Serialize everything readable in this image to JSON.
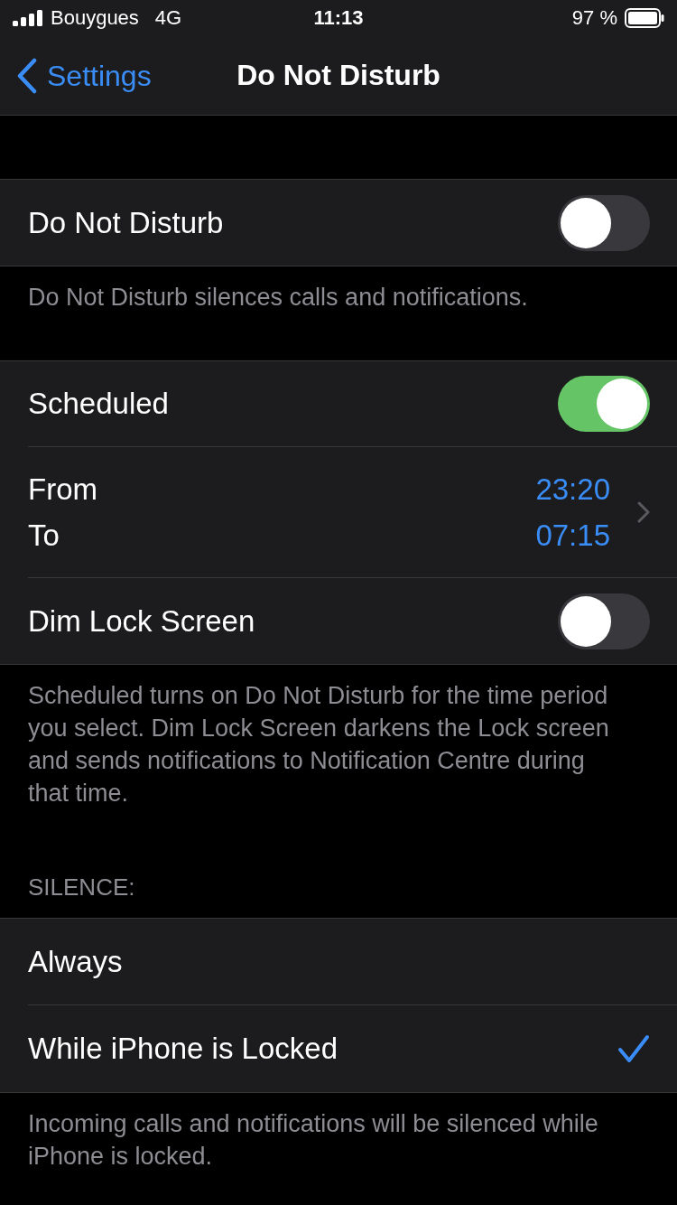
{
  "status_bar": {
    "carrier": "Bouygues",
    "network": "4G",
    "time": "11:13",
    "battery": "97 %"
  },
  "nav": {
    "back": "Settings",
    "title": "Do Not Disturb"
  },
  "sections": [
    {
      "rows": [
        {
          "kind": "toggle",
          "label": "Do Not Disturb",
          "on": false
        }
      ],
      "footer": "Do Not Disturb silences calls and notifications."
    },
    {
      "rows": [
        {
          "kind": "toggle",
          "label": "Scheduled",
          "on": true
        },
        {
          "kind": "schedule",
          "from_label": "From",
          "to_label": "To",
          "from": "23:20",
          "to": "07:15"
        },
        {
          "kind": "toggle",
          "label": "Dim Lock Screen",
          "on": false
        }
      ],
      "footer": "Scheduled turns on Do Not Disturb for the time period you select. Dim Lock Screen darkens the Lock screen and sends notifications to Notification Centre during that time."
    },
    {
      "header": "SILENCE:",
      "rows": [
        {
          "kind": "option",
          "label": "Always",
          "selected": false
        },
        {
          "kind": "option",
          "label": "While iPhone is Locked",
          "selected": true
        }
      ],
      "footer": "Incoming calls and notifications will be silenced while iPhone is locked."
    }
  ]
}
